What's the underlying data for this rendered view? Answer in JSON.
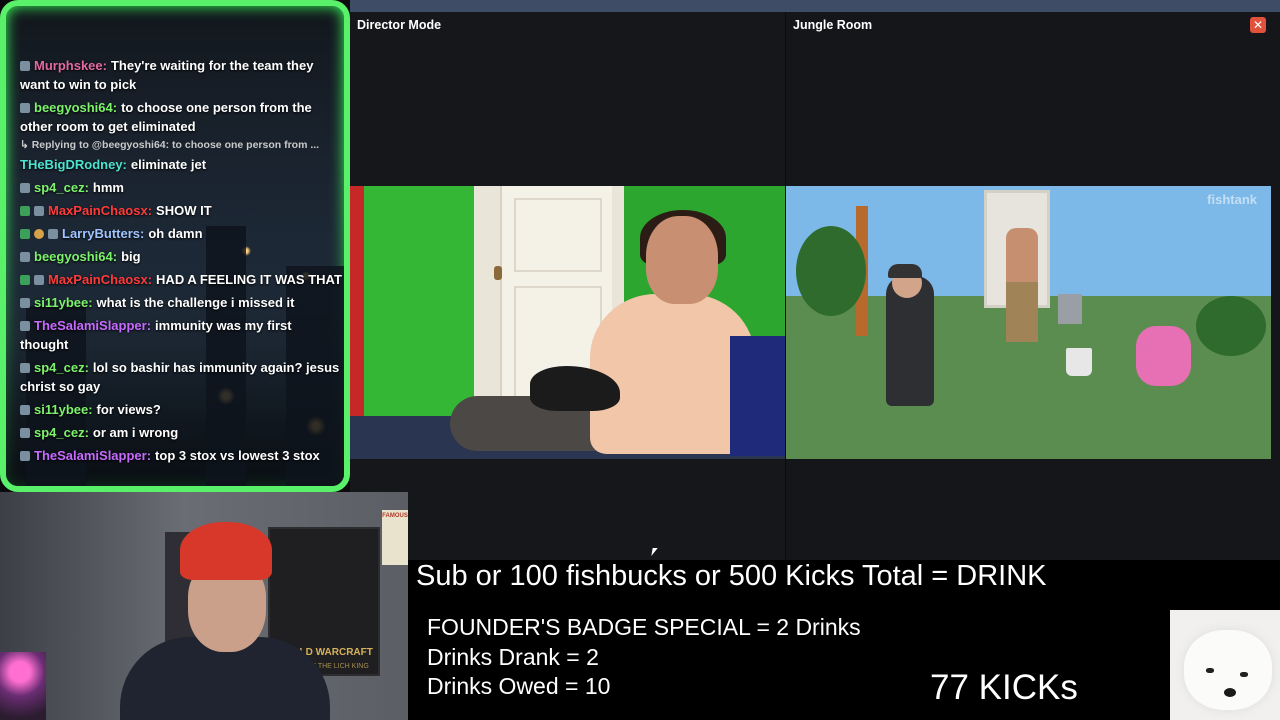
{
  "panels": {
    "left_title": "Director Mode",
    "right_title": "Jungle Room",
    "close_symbol": "✕",
    "watermark": "fishtank"
  },
  "chat": {
    "messages": [
      {
        "user": "Murphskee:",
        "text": "They're waiting for the team they want to win to pick",
        "color": "#e46aa5",
        "badges": [
          "default"
        ]
      },
      {
        "user": "beegyoshi64:",
        "text": "to choose one person from the other room to get eliminated",
        "color": "#7cf36b",
        "badges": [
          "default"
        ]
      },
      {
        "reply": "↳ Replying to @beegyoshi64: to choose one person from ..."
      },
      {
        "user": "THeBigDRodney:",
        "text": "eliminate jet",
        "color": "#4de3d1",
        "badges": []
      },
      {
        "user": "sp4_cez:",
        "text": "hmm",
        "color": "#7cf36b",
        "badges": [
          "default"
        ]
      },
      {
        "user": "MaxPainChaosx:",
        "text": "SHOW IT",
        "color": "#ff3b3b",
        "badges": [
          "mod",
          "default"
        ]
      },
      {
        "user": "LarryButters:",
        "text": "oh damn",
        "color": "#9fc4ff",
        "badges": [
          "mod",
          "sub",
          "default"
        ]
      },
      {
        "user": "beegyoshi64:",
        "text": "big",
        "color": "#7cf36b",
        "badges": [
          "default"
        ]
      },
      {
        "user": "MaxPainChaosx:",
        "text": "HAD A FEELING IT WAS THAT",
        "color": "#ff3b3b",
        "badges": [
          "mod",
          "default"
        ]
      },
      {
        "user": "si11ybee:",
        "text": "what is the challenge i missed it",
        "color": "#7cf36b",
        "badges": [
          "default"
        ]
      },
      {
        "user": "TheSalamiSlapper:",
        "text": "immunity was my first thought",
        "color": "#c76bff",
        "badges": [
          "default"
        ]
      },
      {
        "user": "sp4_cez:",
        "text": "lol so bashir has immunity again? jesus christ so gay",
        "color": "#7cf36b",
        "badges": [
          "default"
        ]
      },
      {
        "user": "si11ybee:",
        "text": "for views?",
        "color": "#7cf36b",
        "badges": [
          "default"
        ]
      },
      {
        "user": "sp4_cez:",
        "text": "or am i wrong",
        "color": "#7cf36b",
        "badges": [
          "default"
        ]
      },
      {
        "user": "TheSalamiSlapper:",
        "text": "top 3 stox vs lowest 3 stox",
        "color": "#c76bff",
        "badges": [
          "default"
        ]
      }
    ]
  },
  "overlay": {
    "headline": "Sub or 100 fishbucks or 500 Kicks Total = DRINK",
    "founders": "FOUNDER'S BADGE SPECIAL = 2 Drinks",
    "drank": "Drinks Drank = 2",
    "owed": "Drinks Owed = 10",
    "kicks": "77 KICKs"
  },
  "webcam": {
    "poster_title": "WORLD WARCRAFT",
    "poster_sub": "WRATH OF THE LICH KING",
    "poster2": "FAMOUS"
  }
}
